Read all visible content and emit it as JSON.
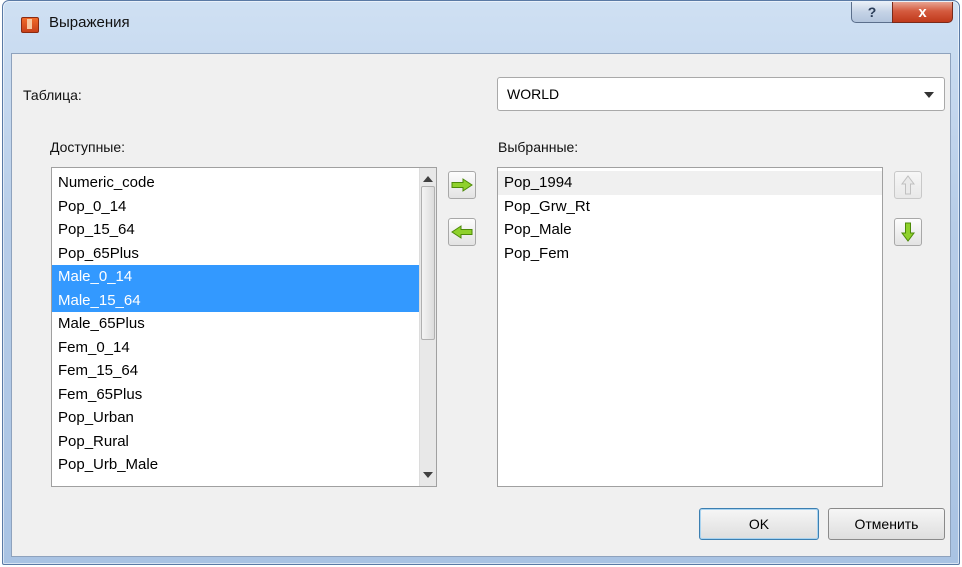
{
  "window": {
    "title": "Выражения",
    "help_label": "?",
    "close_label": "x"
  },
  "table": {
    "label": "Таблица:",
    "selected": "WORLD"
  },
  "available": {
    "label": "Доступные:",
    "items": [
      "Numeric_code",
      "Pop_0_14",
      "Pop_15_64",
      "Pop_65Plus",
      "Male_0_14",
      "Male_15_64",
      "Male_65Plus",
      "Fem_0_14",
      "Fem_15_64",
      "Fem_65Plus",
      "Pop_Urban",
      "Pop_Rural",
      "Pop_Urb_Male"
    ],
    "selected_items": [
      "Male_0_14",
      "Male_15_64"
    ]
  },
  "chosen": {
    "label": "Выбранные:",
    "items": [
      "Pop_1994",
      "Pop_Grw_Rt",
      "Pop_Male",
      "Pop_Fem"
    ],
    "current_item": "Pop_1994"
  },
  "move": {
    "add_icon": "arrow-right-icon",
    "remove_icon": "arrow-left-icon",
    "up_icon": "arrow-up-icon",
    "down_icon": "arrow-down-icon"
  },
  "buttons": {
    "ok": "OK",
    "cancel": "Отменить"
  },
  "colors": {
    "selection": "#3399ff",
    "arrow_green": "#7cc31a",
    "arrow_green_dark": "#4d8a08"
  }
}
